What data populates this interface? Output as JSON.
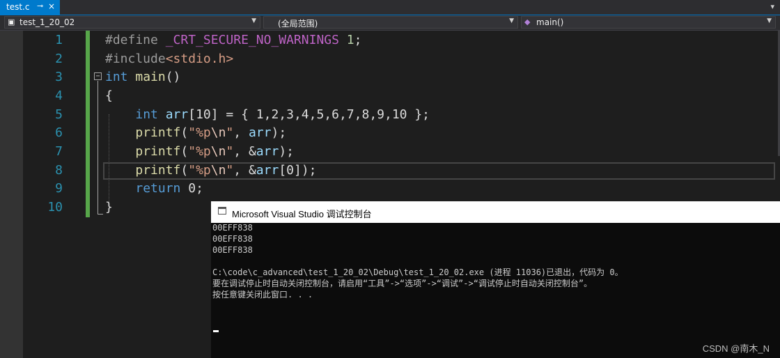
{
  "tab": {
    "label": "test.c",
    "pin_icon": "pin-icon",
    "close": "×"
  },
  "navbar": {
    "project": "test_1_20_02",
    "scope": "(全局范围)",
    "function": "main()"
  },
  "line_numbers": [
    "1",
    "2",
    "3",
    "4",
    "5",
    "6",
    "7",
    "8",
    "9",
    "10"
  ],
  "code": {
    "l1": {
      "kw": "#define",
      "macro": "_CRT_SECURE_NO_WARNINGS",
      "num": "1",
      "end": ";"
    },
    "l2": {
      "kw": "#include",
      "hdr": "<stdio.h>"
    },
    "l3": {
      "type": "int",
      "fn": "main",
      "rest": "()"
    },
    "l4": {
      "text": "{"
    },
    "l5": {
      "type": "int",
      "var": "arr",
      "rest": "[10] = { 1,2,3,4,5,6,7,8,9,10 };"
    },
    "l6": {
      "fn": "printf",
      "open": "(",
      "s1": "\"%p",
      "esc": "\\n",
      "s2": "\"",
      "mid": ", ",
      "var": "arr",
      "tail": ");"
    },
    "l7": {
      "fn": "printf",
      "open": "(",
      "s1": "\"%p",
      "esc": "\\n",
      "s2": "\"",
      "mid": ", &",
      "var": "arr",
      "tail": ");"
    },
    "l8": {
      "fn": "printf",
      "open": "(",
      "s1": "\"%p",
      "esc": "\\n",
      "s2": "\"",
      "mid": ", &",
      "var": "arr",
      "tail": "[0]);"
    },
    "l9": {
      "kw": "return",
      "rest": " 0;"
    },
    "l10": {
      "text": "}"
    }
  },
  "console": {
    "title": "Microsoft Visual Studio 调试控制台",
    "lines": [
      "00EFF838",
      "00EFF838",
      "00EFF838",
      "",
      "C:\\code\\c_advanced\\test_1_20_02\\Debug\\test_1_20_02.exe (进程 11036)已退出，代码为 0。",
      "要在调试停止时自动关闭控制台，请启用“工具”->“选项”->“调试”->“调试停止时自动关闭控制台”。",
      "按任意键关闭此窗口. . ."
    ]
  },
  "watermark": "CSDN @南木_N"
}
